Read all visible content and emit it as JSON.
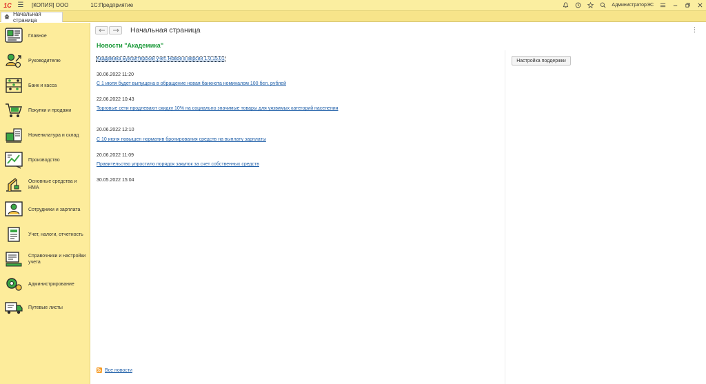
{
  "titlebar": {
    "logo": "1С",
    "org": "[КОПИЯ] ООО",
    "app": "1С:Предприятие",
    "user": "АдминистраторЭС"
  },
  "tabs": [
    {
      "label": "Начальная страница"
    }
  ],
  "sidebar": {
    "items": [
      {
        "label": "Главное",
        "icon": "home-section-icon"
      },
      {
        "label": "Руководителю",
        "icon": "manager-section-icon"
      },
      {
        "label": "Банк и касса",
        "icon": "bank-section-icon"
      },
      {
        "label": "Покупки и продажи",
        "icon": "sales-section-icon"
      },
      {
        "label": "Номенклатура и склад",
        "icon": "warehouse-section-icon"
      },
      {
        "label": "Производство",
        "icon": "production-section-icon"
      },
      {
        "label": "Основные средства и НМА",
        "icon": "assets-section-icon"
      },
      {
        "label": "Сотрудники и зарплата",
        "icon": "staff-section-icon"
      },
      {
        "label": "Учет, налоги, отчетность",
        "icon": "accounting-section-icon"
      },
      {
        "label": "Справочники и настройки учета",
        "icon": "settings-section-icon"
      },
      {
        "label": "Администрирование",
        "icon": "admin-section-icon"
      },
      {
        "label": "Путевые листы",
        "icon": "waybills-section-icon"
      }
    ]
  },
  "content": {
    "title": "Начальная страница",
    "news_title": "Новости \"Академика\"",
    "support_button": "Настройка поддержки",
    "all_news": "Все новости",
    "news": [
      {
        "date": "",
        "link": "Академика Бухгалтерский учет. Новое в версии 1.0.15.01"
      },
      {
        "date": "30.06.2022 11:20",
        "link": "С 1 июля будет выпущена в обращение новая банкнота номиналом 100 бел. рублей"
      },
      {
        "date": "22.06.2022 10:43",
        "link": "Торговые сети продлевают скидку 10% на социально значимые товары для уязвимых категорий населения"
      },
      {
        "date": "20.06.2022 12:10",
        "link": "С 10 июня повышен норматив бронирования средств на выплату зарплаты"
      },
      {
        "date": "20.06.2022 11:09",
        "link": "Правительство упростило порядок закупок за счет собственных средств"
      },
      {
        "date": "30.05.2022 15:04",
        "link": ""
      }
    ]
  },
  "colors": {
    "sidebar_bg": "#fdec9b",
    "titlebar_bg": "#fbeea0",
    "news_title": "#1f9b3c",
    "link": "#1f5fa8"
  }
}
